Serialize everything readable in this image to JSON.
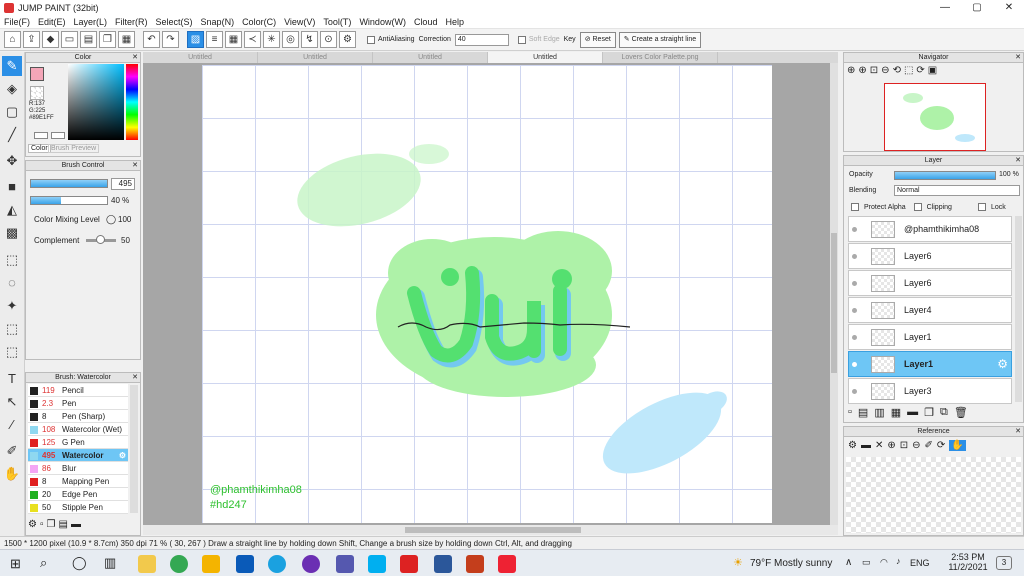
{
  "window": {
    "title": "JUMP PAINT (32bit)",
    "minimize": "—",
    "maximize": "▢",
    "close": "✕"
  },
  "menu": [
    "File(F)",
    "Edit(E)",
    "Layer(L)",
    "Filter(R)",
    "Select(S)",
    "Snap(N)",
    "Color(C)",
    "View(V)",
    "Tool(T)",
    "Window(W)",
    "Cloud",
    "Help"
  ],
  "toolbar": {
    "antialiasing_label": "AntiAliasing",
    "correction_label": "Correction",
    "correction_value": "40",
    "soft_edge_label": "Soft Edge",
    "key_label": "Key",
    "reset_label": "Reset",
    "straight_line_label": "Create a straight line"
  },
  "color_panel": {
    "title": "Color",
    "r": "R:137",
    "g": "G:225",
    "hex": "#89E1FF",
    "tab_color": "Color",
    "tab_preview": "Brush Preview",
    "main_color": "#f4a6b8"
  },
  "brush_control": {
    "title": "Brush Control",
    "size_value": "495",
    "size_fill": 0.86,
    "opacity_value": "40 %",
    "opacity_fill": 0.4,
    "mixing_label": "Color Mixing Level",
    "mixing_value": "100",
    "complement_label": "Complement",
    "complement_value": "50"
  },
  "brush_list": {
    "title": "Brush: Watercolor",
    "items": [
      {
        "size": "119",
        "name": "Pencil",
        "color": "#222222"
      },
      {
        "size": "2.3",
        "name": "Pen",
        "color": "#222222"
      },
      {
        "size": "8",
        "name": "Pen (Sharp)",
        "color": "#222222"
      },
      {
        "size": "108",
        "name": "Watercolor (Wet)",
        "color": "#8fd8f0"
      },
      {
        "size": "125",
        "name": "G Pen",
        "color": "#e02020"
      },
      {
        "size": "495",
        "name": "Watercolor",
        "color": "#8fd8f0"
      },
      {
        "size": "86",
        "name": "Blur",
        "color": "#f4a6f4"
      },
      {
        "size": "8",
        "name": "Mapping Pen",
        "color": "#e02020"
      },
      {
        "size": "20",
        "name": "Edge Pen",
        "color": "#20b020"
      },
      {
        "size": "50",
        "name": "Stipple Pen",
        "color": "#e8e020"
      }
    ]
  },
  "tabs": [
    "Untitled",
    "Untitled",
    "Untitled",
    "Untitled",
    "Lovers Color Palette.png"
  ],
  "canvas": {
    "art_text": "Vui",
    "watermark_1": "@phamthikimha08",
    "watermark_2": "#hd247"
  },
  "navigator": {
    "title": "Navigator"
  },
  "layer_panel": {
    "title": "Layer",
    "opacity_label": "Opacity",
    "opacity_value": "100 %",
    "blending_label": "Blending",
    "blending_value": "Normal",
    "protect_alpha": "Protect Alpha",
    "clipping": "Clipping",
    "lock": "Lock",
    "layers": [
      "@phamthikimha08",
      "Layer6",
      "Layer6",
      "Layer4",
      "Layer1",
      "Layer1",
      "Layer3"
    ]
  },
  "reference": {
    "title": "Reference"
  },
  "status": "1500 * 1200 pixel   (10.9 * 8.7cm)   350 dpi   71 %   ( 30, 267 )   Draw a straight line by holding down Shift, Change a brush size by holding down Ctrl, Alt, and dragging",
  "taskbar": {
    "weather": "79°F  Mostly sunny",
    "lang": "ENG",
    "time": "2:53 PM",
    "date": "11/2/2021",
    "notif": "3"
  }
}
